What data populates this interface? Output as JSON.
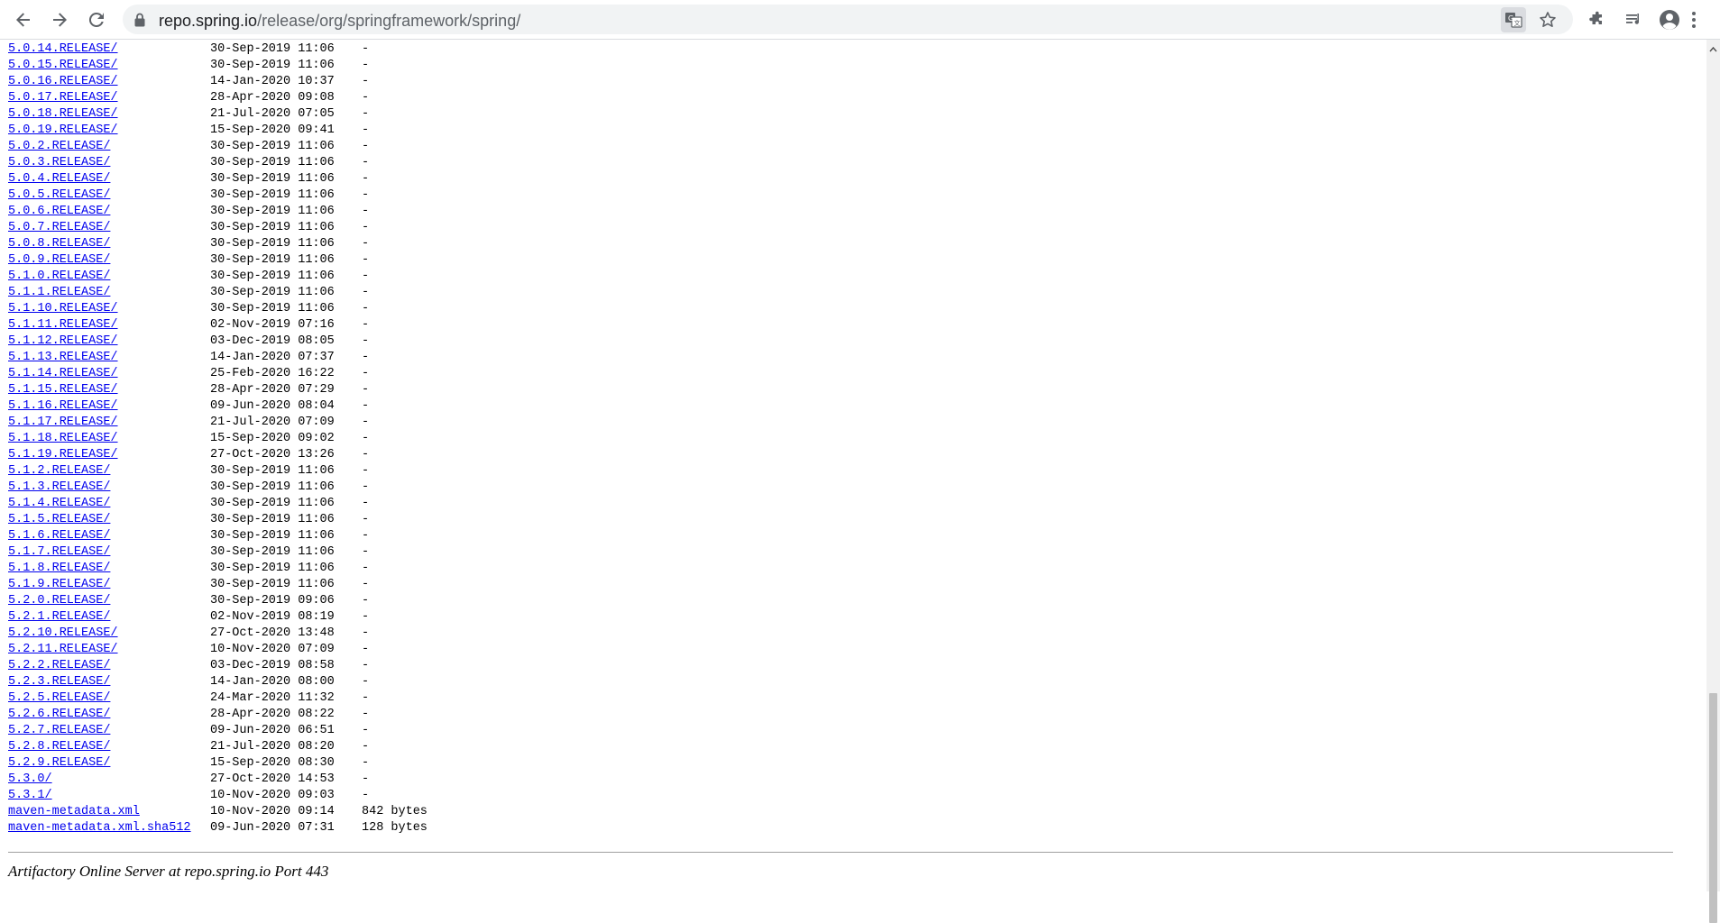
{
  "browser": {
    "url_host": "repo.spring.io",
    "url_path": "/release/org/springframework/spring/"
  },
  "listing": {
    "rows": [
      {
        "name": "5.0.14.RELEASE/",
        "date": "30-Sep-2019 11:06",
        "size": "-"
      },
      {
        "name": "5.0.15.RELEASE/",
        "date": "30-Sep-2019 11:06",
        "size": "-"
      },
      {
        "name": "5.0.16.RELEASE/",
        "date": "14-Jan-2020 10:37",
        "size": "-"
      },
      {
        "name": "5.0.17.RELEASE/",
        "date": "28-Apr-2020 09:08",
        "size": "-"
      },
      {
        "name": "5.0.18.RELEASE/",
        "date": "21-Jul-2020 07:05",
        "size": "-"
      },
      {
        "name": "5.0.19.RELEASE/",
        "date": "15-Sep-2020 09:41",
        "size": "-"
      },
      {
        "name": "5.0.2.RELEASE/",
        "date": "30-Sep-2019 11:06",
        "size": "-"
      },
      {
        "name": "5.0.3.RELEASE/",
        "date": "30-Sep-2019 11:06",
        "size": "-"
      },
      {
        "name": "5.0.4.RELEASE/",
        "date": "30-Sep-2019 11:06",
        "size": "-"
      },
      {
        "name": "5.0.5.RELEASE/",
        "date": "30-Sep-2019 11:06",
        "size": "-"
      },
      {
        "name": "5.0.6.RELEASE/",
        "date": "30-Sep-2019 11:06",
        "size": "-"
      },
      {
        "name": "5.0.7.RELEASE/",
        "date": "30-Sep-2019 11:06",
        "size": "-"
      },
      {
        "name": "5.0.8.RELEASE/",
        "date": "30-Sep-2019 11:06",
        "size": "-"
      },
      {
        "name": "5.0.9.RELEASE/",
        "date": "30-Sep-2019 11:06",
        "size": "-"
      },
      {
        "name": "5.1.0.RELEASE/",
        "date": "30-Sep-2019 11:06",
        "size": "-"
      },
      {
        "name": "5.1.1.RELEASE/",
        "date": "30-Sep-2019 11:06",
        "size": "-"
      },
      {
        "name": "5.1.10.RELEASE/",
        "date": "30-Sep-2019 11:06",
        "size": "-"
      },
      {
        "name": "5.1.11.RELEASE/",
        "date": "02-Nov-2019 07:16",
        "size": "-"
      },
      {
        "name": "5.1.12.RELEASE/",
        "date": "03-Dec-2019 08:05",
        "size": "-"
      },
      {
        "name": "5.1.13.RELEASE/",
        "date": "14-Jan-2020 07:37",
        "size": "-"
      },
      {
        "name": "5.1.14.RELEASE/",
        "date": "25-Feb-2020 16:22",
        "size": "-"
      },
      {
        "name": "5.1.15.RELEASE/",
        "date": "28-Apr-2020 07:29",
        "size": "-"
      },
      {
        "name": "5.1.16.RELEASE/",
        "date": "09-Jun-2020 08:04",
        "size": "-"
      },
      {
        "name": "5.1.17.RELEASE/",
        "date": "21-Jul-2020 07:09",
        "size": "-"
      },
      {
        "name": "5.1.18.RELEASE/",
        "date": "15-Sep-2020 09:02",
        "size": "-"
      },
      {
        "name": "5.1.19.RELEASE/",
        "date": "27-Oct-2020 13:26",
        "size": "-"
      },
      {
        "name": "5.1.2.RELEASE/",
        "date": "30-Sep-2019 11:06",
        "size": "-"
      },
      {
        "name": "5.1.3.RELEASE/",
        "date": "30-Sep-2019 11:06",
        "size": "-"
      },
      {
        "name": "5.1.4.RELEASE/",
        "date": "30-Sep-2019 11:06",
        "size": "-"
      },
      {
        "name": "5.1.5.RELEASE/",
        "date": "30-Sep-2019 11:06",
        "size": "-"
      },
      {
        "name": "5.1.6.RELEASE/",
        "date": "30-Sep-2019 11:06",
        "size": "-"
      },
      {
        "name": "5.1.7.RELEASE/",
        "date": "30-Sep-2019 11:06",
        "size": "-"
      },
      {
        "name": "5.1.8.RELEASE/",
        "date": "30-Sep-2019 11:06",
        "size": "-"
      },
      {
        "name": "5.1.9.RELEASE/",
        "date": "30-Sep-2019 11:06",
        "size": "-"
      },
      {
        "name": "5.2.0.RELEASE/",
        "date": "30-Sep-2019 09:06",
        "size": "-"
      },
      {
        "name": "5.2.1.RELEASE/",
        "date": "02-Nov-2019 08:19",
        "size": "-"
      },
      {
        "name": "5.2.10.RELEASE/",
        "date": "27-Oct-2020 13:48",
        "size": "-"
      },
      {
        "name": "5.2.11.RELEASE/",
        "date": "10-Nov-2020 07:09",
        "size": "-"
      },
      {
        "name": "5.2.2.RELEASE/",
        "date": "03-Dec-2019 08:58",
        "size": "-"
      },
      {
        "name": "5.2.3.RELEASE/",
        "date": "14-Jan-2020 08:00",
        "size": "-"
      },
      {
        "name": "5.2.5.RELEASE/",
        "date": "24-Mar-2020 11:32",
        "size": "-"
      },
      {
        "name": "5.2.6.RELEASE/",
        "date": "28-Apr-2020 08:22",
        "size": "-"
      },
      {
        "name": "5.2.7.RELEASE/",
        "date": "09-Jun-2020 06:51",
        "size": "-"
      },
      {
        "name": "5.2.8.RELEASE/",
        "date": "21-Jul-2020 08:20",
        "size": "-"
      },
      {
        "name": "5.2.9.RELEASE/",
        "date": "15-Sep-2020 08:30",
        "size": "-"
      },
      {
        "name": "5.3.0/",
        "date": "27-Oct-2020 14:53",
        "size": "-"
      },
      {
        "name": "5.3.1/",
        "date": "10-Nov-2020 09:03",
        "size": "-"
      },
      {
        "name": "maven-metadata.xml",
        "date": "10-Nov-2020 09:14",
        "size": "842 bytes"
      },
      {
        "name": "maven-metadata.xml.sha512",
        "date": "09-Jun-2020 07:31",
        "size": "128 bytes"
      }
    ]
  },
  "footer": {
    "text": "Artifactory Online Server at repo.spring.io Port 443"
  },
  "colors": {
    "link": "#0000ee",
    "toolbar_icon": "#5f6368",
    "omnibox_bg": "#f1f3f4"
  },
  "icons": [
    "back-arrow-icon",
    "forward-arrow-icon",
    "reload-icon",
    "lock-icon",
    "translate-icon",
    "star-icon",
    "extensions-puzzle-icon",
    "reading-list-icon",
    "profile-avatar-icon",
    "kebab-menu-icon"
  ]
}
